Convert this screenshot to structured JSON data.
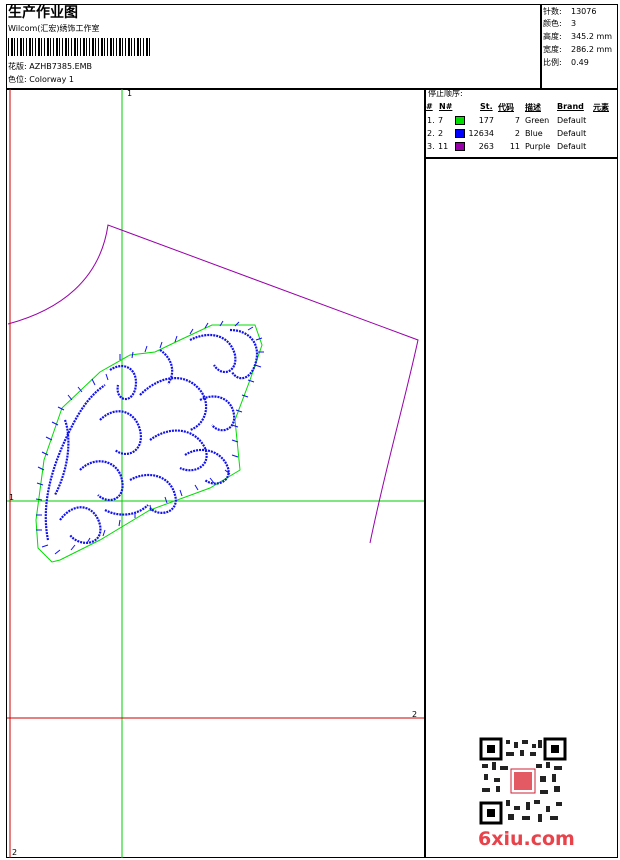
{
  "header": {
    "title": "生产作业图",
    "subtitle": "Wilcom(汇宏)绣饰工作室",
    "design_label": "花版: AZHB7385.EMB",
    "colorway_label": "色位: Colorway 1"
  },
  "stats": [
    {
      "label": "针数:",
      "value": "13076"
    },
    {
      "label": "颜色:",
      "value": "3"
    },
    {
      "label": "高度:",
      "value": "345.2 mm"
    },
    {
      "label": "宽度:",
      "value": "286.2 mm"
    },
    {
      "label": "比例:",
      "value": "0.49"
    }
  ],
  "stop_sequence": {
    "title": "停止顺序:",
    "headers": [
      "#",
      "N#",
      "St.",
      "代码",
      "描述",
      "Brand",
      "元素"
    ],
    "rows": [
      {
        "index": "1.",
        "n": "7",
        "color": "#00dd00",
        "stitches": "177",
        "code": "7",
        "desc": "Green",
        "brand": "Default"
      },
      {
        "index": "2.",
        "n": "2",
        "color": "#0000ff",
        "stitches": "12634",
        "code": "2",
        "desc": "Blue",
        "brand": "Default"
      },
      {
        "index": "3.",
        "n": "11",
        "color": "#9900aa",
        "stitches": "263",
        "code": "11",
        "desc": "Purple",
        "brand": "Default"
      }
    ]
  },
  "markers": {
    "top": "1",
    "left": "1",
    "right": "2",
    "bottom": "2"
  },
  "watermark": "6xiu.com",
  "colors": {
    "guide_green": "#00cc00",
    "guide_red": "#cc0000",
    "outline_purple": "#9900aa",
    "embroidery_blue": "#1111ee",
    "watermark_red": "#e8424a"
  }
}
